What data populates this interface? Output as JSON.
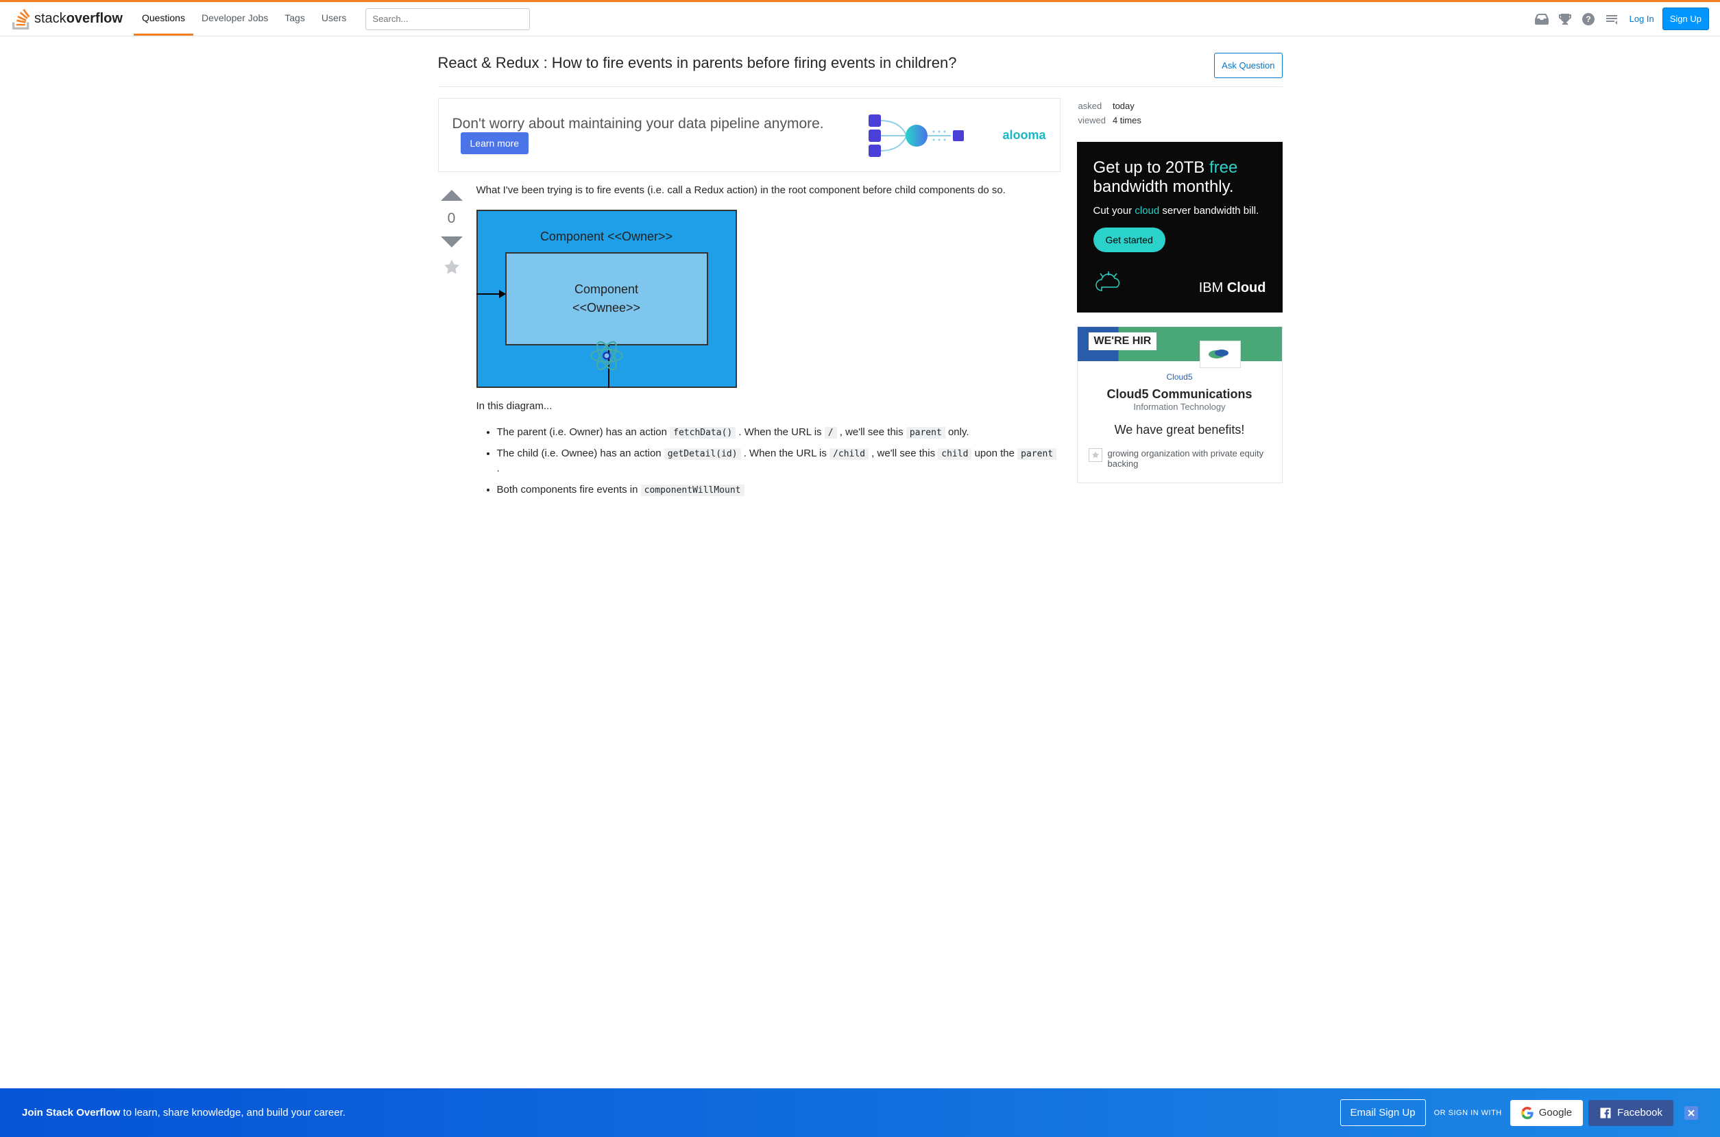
{
  "header": {
    "logo_text_1": "stack",
    "logo_text_2": "overflow",
    "nav": [
      "Questions",
      "Developer Jobs",
      "Tags",
      "Users"
    ],
    "search_placeholder": "Search...",
    "login": "Log In",
    "signup": "Sign Up"
  },
  "question": {
    "title": "React & Redux : How to fire events in parents before firing events in children?",
    "ask_button": "Ask Question",
    "asked_label": "asked",
    "asked_value": "today",
    "viewed_label": "viewed",
    "viewed_value": "4 times",
    "vote_count": "0"
  },
  "ad_top": {
    "text": "Don't worry about maintaining your data pipeline anymore.",
    "button": "Learn more",
    "brand": "alooma"
  },
  "post": {
    "intro": "What I've been trying is to fire events (i.e. call a Redux action) in the root component before child components do so.",
    "diagram": {
      "owner": "Component <<Owner>>",
      "ownee_1": "Component",
      "ownee_2": "<<Ownee>>"
    },
    "diag_caption": "In this diagram...",
    "bullet1_a": "The parent (i.e. Owner) has an action ",
    "bullet1_code1": "fetchData()",
    "bullet1_b": " . When the URL is ",
    "bullet1_code2": "/",
    "bullet1_c": " , we'll see this ",
    "bullet1_code3": "parent",
    "bullet1_d": " only.",
    "bullet2_a": "The child (i.e. Ownee) has an action ",
    "bullet2_code1": "getDetail(id)",
    "bullet2_b": " . When the URL is ",
    "bullet2_code2": "/child",
    "bullet2_c": " , we'll see this ",
    "bullet2_code3": "child",
    "bullet2_d": " upon the ",
    "bullet2_code4": "parent",
    "bullet2_e": " .",
    "bullet3_a": "Both components fire events in ",
    "bullet3_code1": "componentWillMount"
  },
  "side_ad": {
    "line1a": "Get up to 20TB ",
    "line1b": "free",
    "line1c": " bandwidth monthly.",
    "line2a": "Cut your ",
    "line2b": "cloud",
    "line2c": " server bandwidth bill.",
    "button": "Get started",
    "brand_a": "IBM ",
    "brand_b": "Cloud"
  },
  "hiring": {
    "badge": "WE'RE HIR",
    "logo": "Cloud5",
    "company": "Cloud5 Communications",
    "category": "Information Technology",
    "tagline": "We have great benefits!",
    "item1": "growing organization with private equity backing"
  },
  "footer": {
    "text_bold": "Join Stack Overflow",
    "text_rest": " to learn, share knowledge, and build your career.",
    "email_btn": "Email Sign Up",
    "or": "OR SIGN IN WITH",
    "google": "Google",
    "facebook": "Facebook"
  }
}
